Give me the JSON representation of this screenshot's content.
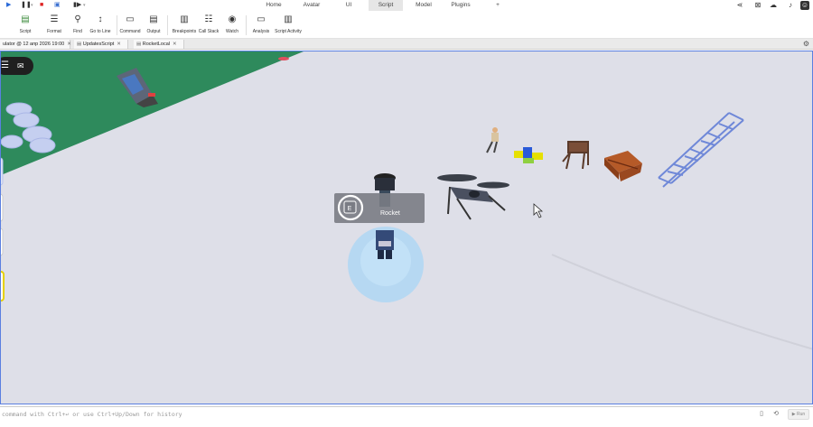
{
  "menubar": {
    "tabs": [
      "Home",
      "Avatar",
      "UI",
      "Script",
      "Model",
      "Plugins"
    ],
    "active_tab": "Script",
    "add_tab_label": "+"
  },
  "ribbon": {
    "buttons": [
      {
        "label": "Script",
        "icon": "script-icon"
      },
      {
        "label": "Format",
        "icon": "format-icon"
      },
      {
        "label": "Find",
        "icon": "find-icon"
      },
      {
        "label": "Go to Line",
        "icon": "goto-line-icon"
      },
      {
        "label": "Command",
        "icon": "command-icon"
      },
      {
        "label": "Output",
        "icon": "output-icon"
      },
      {
        "label": "Breakpoints",
        "icon": "breakpoints-icon"
      },
      {
        "label": "Call Stack",
        "icon": "call-stack-icon"
      },
      {
        "label": "Watch",
        "icon": "watch-icon"
      },
      {
        "label": "Analysis",
        "icon": "analysis-icon"
      },
      {
        "label": "Script Activity",
        "icon": "script-activity-icon"
      }
    ]
  },
  "tabs": [
    {
      "label": "ulator @ 12 апр 2026 19:00"
    },
    {
      "label": "UpdatesScript"
    },
    {
      "label": "RocketLocal"
    }
  ],
  "viewport": {
    "prompt_key": "E",
    "prompt_text": "Rocket",
    "colors": {
      "ground": "#dedfe8",
      "grass": "#2e8a5c",
      "selection_border": "#5a7fe0"
    }
  },
  "command_bar": {
    "placeholder": "command with Ctrl+↩ or use Ctrl+Up/Down for history",
    "run_label": "Run"
  }
}
